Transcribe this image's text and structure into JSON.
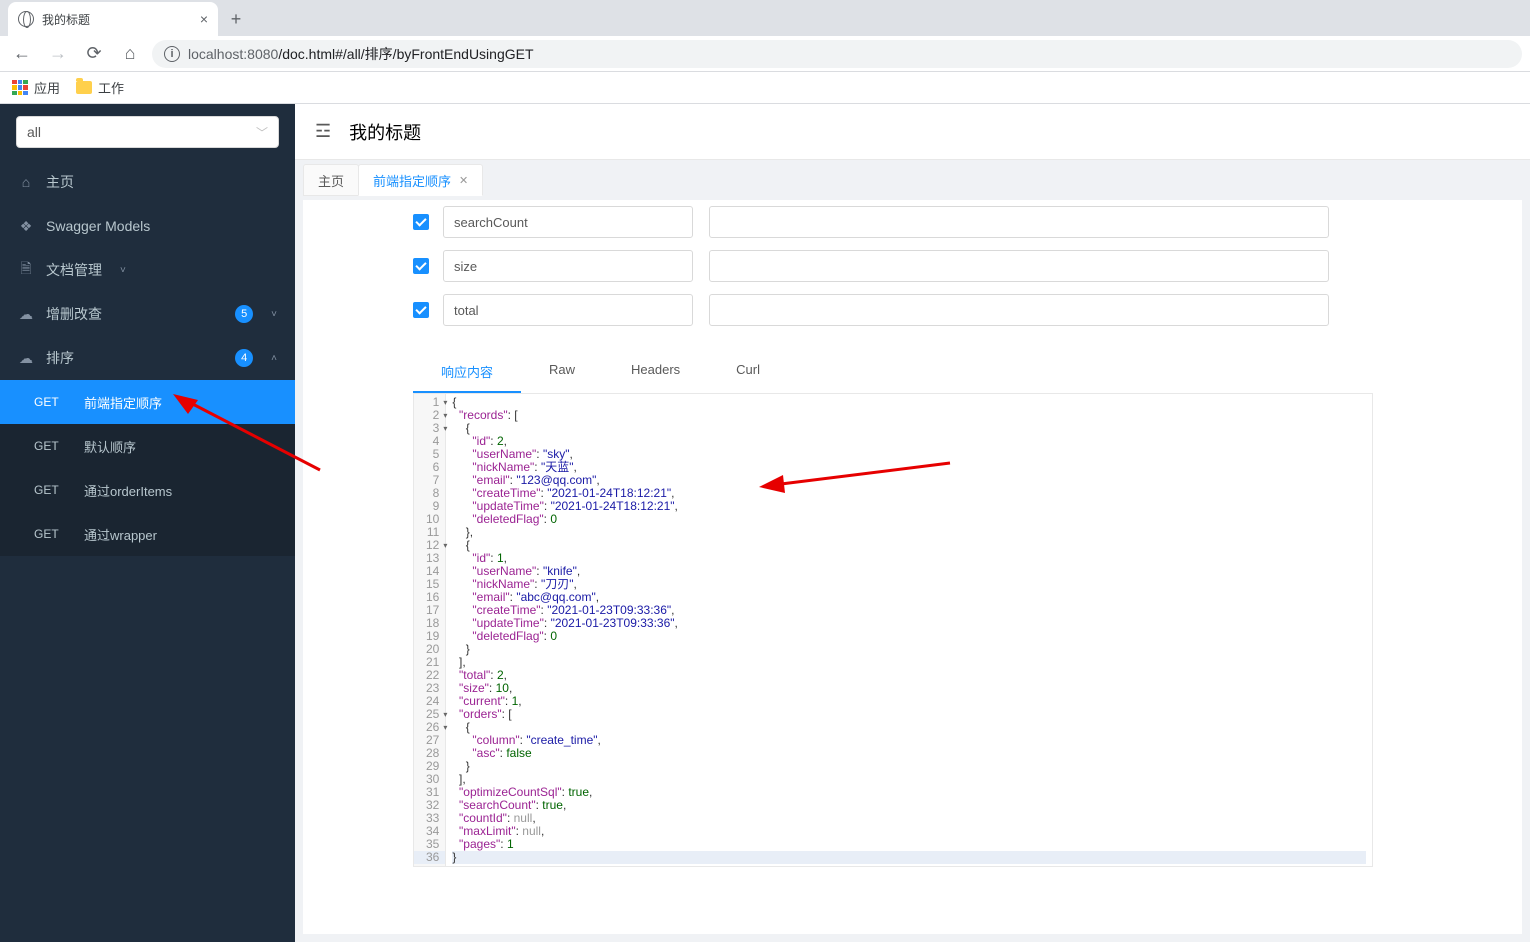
{
  "browser": {
    "tab_title": "我的标题",
    "url_host": "localhost",
    "url_port": ":8080",
    "url_path": "/doc.html#/all/排序/byFrontEndUsingGET",
    "bookmarks": {
      "apps": "应用",
      "work": "工作"
    }
  },
  "sidebar": {
    "select_value": "all",
    "items": [
      {
        "icon": "home",
        "label": "主页"
      },
      {
        "icon": "models",
        "label": "Swagger Models"
      },
      {
        "icon": "doc",
        "label": "文档管理",
        "expandable": true
      },
      {
        "icon": "cloud",
        "label": "增删改查",
        "badge": "5",
        "expandable": true
      },
      {
        "icon": "cloud",
        "label": "排序",
        "badge": "4",
        "expandable": true,
        "expanded": true
      }
    ],
    "sort_children": [
      {
        "method": "GET",
        "label": "前端指定顺序",
        "active": true
      },
      {
        "method": "GET",
        "label": "默认顺序"
      },
      {
        "method": "GET",
        "label": "通过orderItems"
      },
      {
        "method": "GET",
        "label": "通过wrapper"
      }
    ]
  },
  "header": {
    "title": "我的标题"
  },
  "tabs": [
    {
      "label": "主页",
      "closable": false
    },
    {
      "label": "前端指定顺序",
      "closable": true,
      "active": true
    }
  ],
  "params": [
    {
      "checked": true,
      "name": "searchCount",
      "value": ""
    },
    {
      "checked": true,
      "name": "size",
      "value": ""
    },
    {
      "checked": true,
      "name": "total",
      "value": ""
    }
  ],
  "response_tabs": [
    {
      "label": "响应内容",
      "active": true
    },
    {
      "label": "Raw"
    },
    {
      "label": "Headers"
    },
    {
      "label": "Curl"
    }
  ],
  "json_response": {
    "records": [
      {
        "id": 2,
        "userName": "sky",
        "nickName": "天蓝",
        "email": "123@qq.com",
        "createTime": "2021-01-24T18:12:21",
        "updateTime": "2021-01-24T18:12:21",
        "deletedFlag": 0
      },
      {
        "id": 1,
        "userName": "knife",
        "nickName": "刀刃",
        "email": "abc@qq.com",
        "createTime": "2021-01-23T09:33:36",
        "updateTime": "2021-01-23T09:33:36",
        "deletedFlag": 0
      }
    ],
    "total": 2,
    "size": 10,
    "current": 1,
    "orders": [
      {
        "column": "create_time",
        "asc": false
      }
    ],
    "optimizeCountSql": true,
    "searchCount": true,
    "countId": null,
    "maxLimit": null,
    "pages": 1
  },
  "code_lines": [
    "{",
    "  \"records\": [",
    "    {",
    "      \"id\": 2,",
    "      \"userName\": \"sky\",",
    "      \"nickName\": \"天蓝\",",
    "      \"email\": \"123@qq.com\",",
    "      \"createTime\": \"2021-01-24T18:12:21\",",
    "      \"updateTime\": \"2021-01-24T18:12:21\",",
    "      \"deletedFlag\": 0",
    "    },",
    "    {",
    "      \"id\": 1,",
    "      \"userName\": \"knife\",",
    "      \"nickName\": \"刀刃\",",
    "      \"email\": \"abc@qq.com\",",
    "      \"createTime\": \"2021-01-23T09:33:36\",",
    "      \"updateTime\": \"2021-01-23T09:33:36\",",
    "      \"deletedFlag\": 0",
    "    }",
    "  ],",
    "  \"total\": 2,",
    "  \"size\": 10,",
    "  \"current\": 1,",
    "  \"orders\": [",
    "    {",
    "      \"column\": \"create_time\",",
    "      \"asc\": false",
    "    }",
    "  ],",
    "  \"optimizeCountSql\": true,",
    "  \"searchCount\": true,",
    "  \"countId\": null,",
    "  \"maxLimit\": null,",
    "  \"pages\": 1",
    "}"
  ],
  "fold_lines": [
    1,
    2,
    3,
    12,
    25,
    26
  ]
}
